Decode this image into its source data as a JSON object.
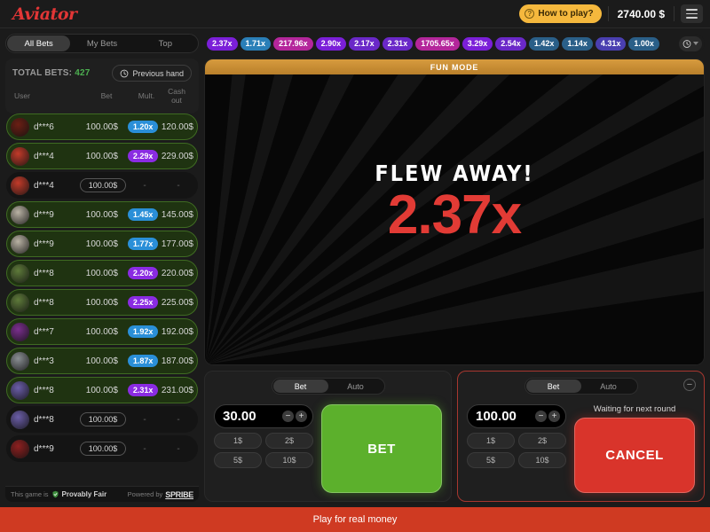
{
  "header": {
    "logo": "Aviator",
    "how_to_play": "How to play?",
    "balance": "2740.00 $",
    "menu_icon": "hamburger-menu-icon",
    "question_icon": "question-mark-icon"
  },
  "sidebar": {
    "tabs": [
      {
        "label": "All Bets",
        "active": true
      },
      {
        "label": "My Bets",
        "active": false
      },
      {
        "label": "Top",
        "active": false
      }
    ],
    "total_bets_label": "TOTAL BETS:",
    "total_bets_value": "427",
    "previous_hand_label": "Previous hand",
    "previous_hand_icon": "history-clock-icon",
    "columns": [
      "User",
      "Bet",
      "Mult.",
      "Cash out"
    ],
    "rows": [
      {
        "user": "d***6",
        "bet": "100.00$",
        "mult": "1.20x",
        "cashout": "120.00$",
        "won": true,
        "chip_color": "#2a8fd8",
        "avatar": "#6b1f14"
      },
      {
        "user": "d***4",
        "bet": "100.00$",
        "mult": "2.29x",
        "cashout": "229.00$",
        "won": true,
        "chip_color": "#8a2be2",
        "avatar": "#c23b2a"
      },
      {
        "user": "d***4",
        "bet": "100.00$",
        "mult": "-",
        "cashout": "-",
        "won": false,
        "chip_color": "",
        "avatar": "#c23b2a"
      },
      {
        "user": "d***9",
        "bet": "100.00$",
        "mult": "1.45x",
        "cashout": "145.00$",
        "won": true,
        "chip_color": "#2a8fd8",
        "avatar": "#b9b2a4"
      },
      {
        "user": "d***9",
        "bet": "100.00$",
        "mult": "1.77x",
        "cashout": "177.00$",
        "won": true,
        "chip_color": "#2a8fd8",
        "avatar": "#b9b2a4"
      },
      {
        "user": "d***8",
        "bet": "100.00$",
        "mult": "2.20x",
        "cashout": "220.00$",
        "won": true,
        "chip_color": "#8a2be2",
        "avatar": "#5e7a3a"
      },
      {
        "user": "d***8",
        "bet": "100.00$",
        "mult": "2.25x",
        "cashout": "225.00$",
        "won": true,
        "chip_color": "#8a2be2",
        "avatar": "#5e7a3a"
      },
      {
        "user": "d***7",
        "bet": "100.00$",
        "mult": "1.92x",
        "cashout": "192.00$",
        "won": true,
        "chip_color": "#2a8fd8",
        "avatar": "#7b2f8e"
      },
      {
        "user": "d***3",
        "bet": "100.00$",
        "mult": "1.87x",
        "cashout": "187.00$",
        "won": true,
        "chip_color": "#2a8fd8",
        "avatar": "#8a8f93"
      },
      {
        "user": "d***8",
        "bet": "100.00$",
        "mult": "2.31x",
        "cashout": "231.00$",
        "won": true,
        "chip_color": "#8a2be2",
        "avatar": "#6b5ea8"
      },
      {
        "user": "d***8",
        "bet": "100.00$",
        "mult": "-",
        "cashout": "-",
        "won": false,
        "chip_color": "",
        "avatar": "#6b5ea8"
      },
      {
        "user": "d***9",
        "bet": "100.00$",
        "mult": "-",
        "cashout": "-",
        "won": false,
        "chip_color": "",
        "avatar": "#8e2020"
      }
    ],
    "footer": {
      "this_game_is": "This game is",
      "provably_fair": "Provably Fair",
      "powered_by": "Powered by",
      "brand": "SPRIBE",
      "shield_icon": "shield-check-icon"
    }
  },
  "history": {
    "chips": [
      {
        "value": "2.37x",
        "color": "#7b1fd8"
      },
      {
        "value": "1.71x",
        "color": "#2a7fb8"
      },
      {
        "value": "217.96x",
        "color": "#b4269b"
      },
      {
        "value": "2.90x",
        "color": "#7b1fd8"
      },
      {
        "value": "2.17x",
        "color": "#6a28c8"
      },
      {
        "value": "2.31x",
        "color": "#6a28c8"
      },
      {
        "value": "1705.65x",
        "color": "#b4269b"
      },
      {
        "value": "3.29x",
        "color": "#7b1fd8"
      },
      {
        "value": "2.54x",
        "color": "#6a28c8"
      },
      {
        "value": "1.42x",
        "color": "#2a5f88"
      },
      {
        "value": "1.14x",
        "color": "#2a5f88"
      },
      {
        "value": "4.31x",
        "color": "#4a3fb0"
      },
      {
        "value": "1.00x",
        "color": "#2a5f88"
      }
    ],
    "toggle_icon": "history-clock-icon"
  },
  "canvas": {
    "fun_mode": "FUN MODE",
    "status_text": "FLEW AWAY!",
    "multiplier": "2.37x",
    "multiplier_color": "#e23b35"
  },
  "bet_panels": [
    {
      "tabs": [
        {
          "label": "Bet",
          "active": true
        },
        {
          "label": "Auto",
          "active": false
        }
      ],
      "amount": "30.00",
      "quick_chips": [
        "1$",
        "2$",
        "5$",
        "10$"
      ],
      "action_label": "BET",
      "action_type": "bet",
      "status": "",
      "has_minus": false,
      "decrement_icon": "minus-icon",
      "increment_icon": "plus-icon"
    },
    {
      "tabs": [
        {
          "label": "Bet",
          "active": true
        },
        {
          "label": "Auto",
          "active": false
        }
      ],
      "amount": "100.00",
      "quick_chips": [
        "1$",
        "2$",
        "5$",
        "10$"
      ],
      "action_label": "CANCEL",
      "action_type": "cancel",
      "status": "Waiting for next round",
      "has_minus": true,
      "decrement_icon": "minus-icon",
      "increment_icon": "plus-icon",
      "remove_icon": "minus-circle-icon"
    }
  ],
  "bottom_bar": {
    "label": "Play for real money"
  }
}
